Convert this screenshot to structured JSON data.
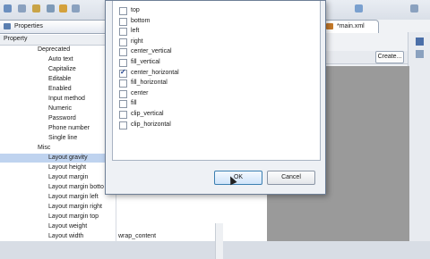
{
  "properties_view": {
    "tab_label": "Properties",
    "header_label": "Property",
    "rows": [
      {
        "label": "Deprecated",
        "value": "",
        "indent": 1
      },
      {
        "label": "Auto text",
        "value": "",
        "indent": 2
      },
      {
        "label": "Capitalize",
        "value": "",
        "indent": 2
      },
      {
        "label": "Editable",
        "value": "",
        "indent": 2
      },
      {
        "label": "Enabled",
        "value": "",
        "indent": 2
      },
      {
        "label": "Input method",
        "value": "",
        "indent": 2
      },
      {
        "label": "Numeric",
        "value": "",
        "indent": 2
      },
      {
        "label": "Password",
        "value": "",
        "indent": 2
      },
      {
        "label": "Phone number",
        "value": "",
        "indent": 2
      },
      {
        "label": "Single line",
        "value": "",
        "indent": 2
      },
      {
        "label": "Misc",
        "value": "",
        "indent": 1
      },
      {
        "label": "Layout gravity",
        "value": "",
        "indent": 2,
        "selected": true
      },
      {
        "label": "Layout height",
        "value": "",
        "indent": 2
      },
      {
        "label": "Layout margin",
        "value": "",
        "indent": 2
      },
      {
        "label": "Layout margin botto",
        "value": "",
        "indent": 2
      },
      {
        "label": "Layout margin left",
        "value": "",
        "indent": 2
      },
      {
        "label": "Layout margin right",
        "value": "",
        "indent": 2
      },
      {
        "label": "Layout margin top",
        "value": "",
        "indent": 2
      },
      {
        "label": "Layout weight",
        "value": "",
        "indent": 2
      },
      {
        "label": "Layout width",
        "value": "wrap_content",
        "indent": 2
      }
    ]
  },
  "editor": {
    "tab_label": "*main.xml",
    "create_label": "Create..."
  },
  "dialog": {
    "options": [
      {
        "label": "top",
        "checked": false
      },
      {
        "label": "bottom",
        "checked": false
      },
      {
        "label": "left",
        "checked": false
      },
      {
        "label": "right",
        "checked": false
      },
      {
        "label": "center_vertical",
        "checked": false
      },
      {
        "label": "fill_vertical",
        "checked": false
      },
      {
        "label": "center_horizontal",
        "checked": true
      },
      {
        "label": "fill_horizontal",
        "checked": false
      },
      {
        "label": "center",
        "checked": false
      },
      {
        "label": "fill",
        "checked": false
      },
      {
        "label": "clip_vertical",
        "checked": false
      },
      {
        "label": "clip_horizontal",
        "checked": false
      }
    ],
    "ok_label": "OK",
    "cancel_label": "Cancel"
  },
  "colors": {
    "selection": "#bfd3ef",
    "canvas": "#9a9a9a",
    "accent": "#3c7fb1"
  }
}
